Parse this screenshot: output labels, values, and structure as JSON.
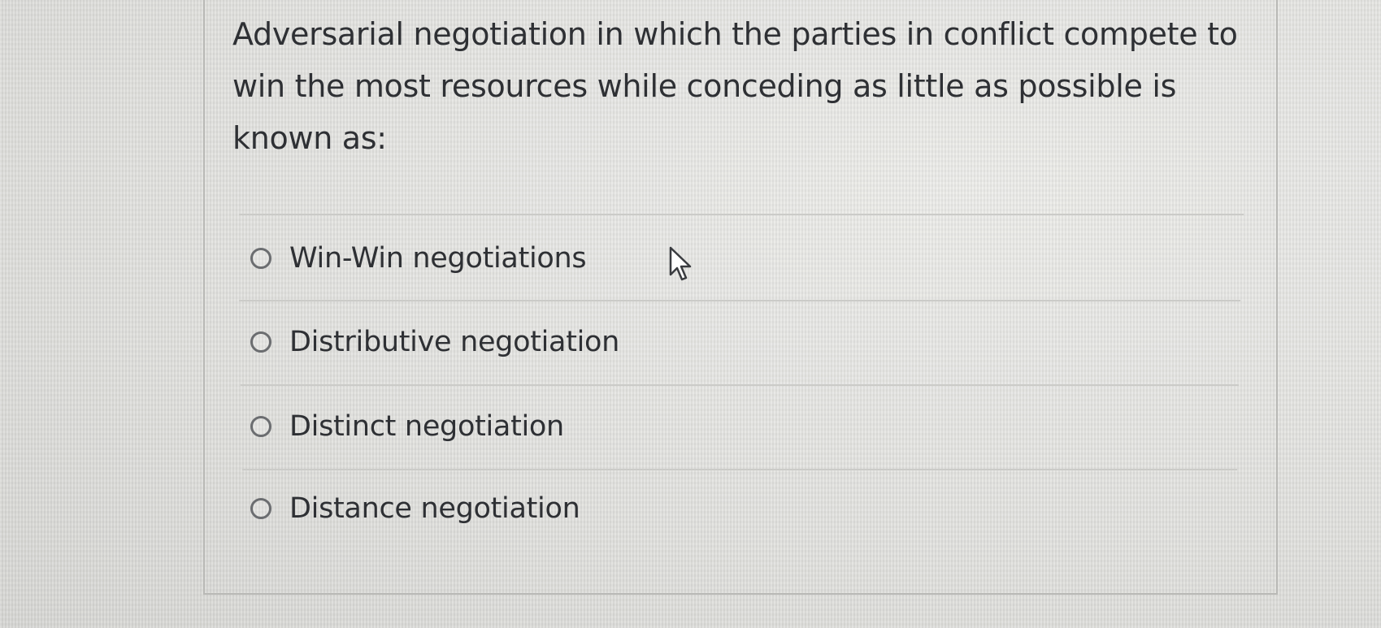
{
  "question": {
    "lines": [
      "Adversarial negotiation in which the parties in conflict compete to",
      "win the most resources while conceding as little as possible is",
      "known as:"
    ]
  },
  "answers": [
    {
      "label": "Win-Win negotiations",
      "selected": false
    },
    {
      "label": "Distributive negotiation",
      "selected": false
    },
    {
      "label": "Distinct negotiation",
      "selected": false
    },
    {
      "label": "Distance negotiation",
      "selected": false
    }
  ],
  "cursor": {
    "icon": "mouse-pointer-icon"
  }
}
